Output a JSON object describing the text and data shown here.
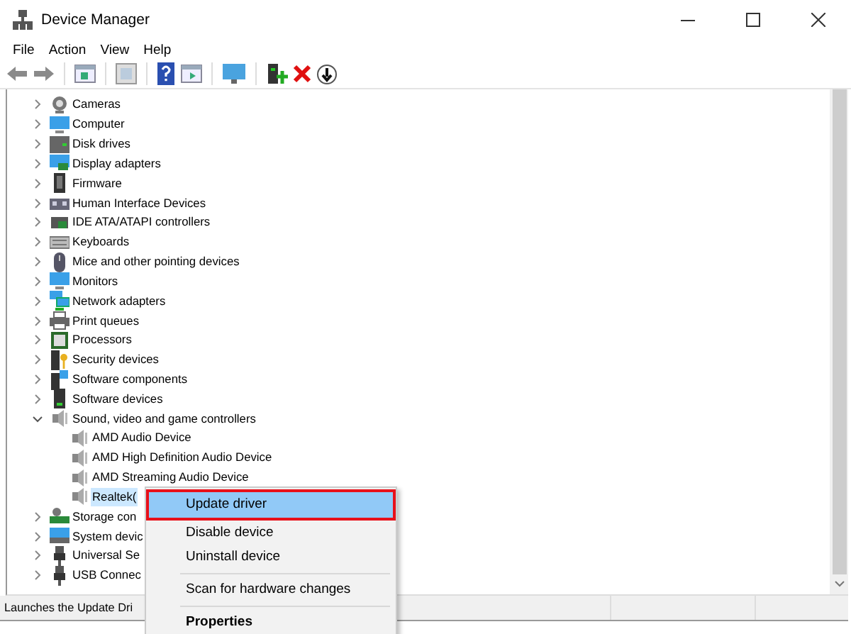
{
  "window": {
    "title": "Device Manager"
  },
  "menu_bar": [
    "File",
    "Action",
    "View",
    "Help"
  ],
  "tree": [
    {
      "label": "Cameras",
      "expanded": false,
      "selected": false
    },
    {
      "label": "Computer",
      "expanded": false,
      "selected": false
    },
    {
      "label": "Disk drives",
      "expanded": false,
      "selected": false
    },
    {
      "label": "Display adapters",
      "expanded": false,
      "selected": false
    },
    {
      "label": "Firmware",
      "expanded": false,
      "selected": false
    },
    {
      "label": "Human Interface Devices",
      "expanded": false,
      "selected": false
    },
    {
      "label": "IDE ATA/ATAPI controllers",
      "expanded": false,
      "selected": false
    },
    {
      "label": "Keyboards",
      "expanded": false,
      "selected": false
    },
    {
      "label": "Mice and other pointing devices",
      "expanded": false,
      "selected": false
    },
    {
      "label": "Monitors",
      "expanded": false,
      "selected": false
    },
    {
      "label": "Network adapters",
      "expanded": false,
      "selected": false
    },
    {
      "label": "Print queues",
      "expanded": false,
      "selected": false
    },
    {
      "label": "Processors",
      "expanded": false,
      "selected": false
    },
    {
      "label": "Security devices",
      "expanded": false,
      "selected": false
    },
    {
      "label": "Software components",
      "expanded": false,
      "selected": false
    },
    {
      "label": "Software devices",
      "expanded": false,
      "selected": false
    },
    {
      "label": "Sound, video and game controllers",
      "expanded": true,
      "selected": false,
      "children": [
        {
          "label": "AMD Audio Device",
          "selected": false
        },
        {
          "label": "AMD High Definition Audio Device",
          "selected": false
        },
        {
          "label": "AMD Streaming Audio Device",
          "selected": false
        },
        {
          "label": "Realtek(",
          "selected": true
        }
      ]
    },
    {
      "label": "Storage con",
      "expanded": false,
      "selected": false
    },
    {
      "label": "System devic",
      "expanded": false,
      "selected": false
    },
    {
      "label": "Universal Se",
      "expanded": false,
      "selected": false
    },
    {
      "label": "USB Connec",
      "expanded": false,
      "selected": false
    }
  ],
  "context_menu": [
    {
      "label": "Update driver",
      "selected": true,
      "outlined": true,
      "default": false
    },
    {
      "label": "Disable device",
      "selected": false,
      "outlined": false,
      "default": false
    },
    {
      "label": "Uninstall device",
      "selected": false,
      "outlined": false,
      "default": false,
      "separator_after": true
    },
    {
      "label": "Scan for hardware changes",
      "selected": false,
      "outlined": false,
      "default": false,
      "separator_after": true
    },
    {
      "label": "Properties",
      "selected": false,
      "outlined": false,
      "default": true
    }
  ],
  "status_bar": {
    "text": "Launches the Update Dri"
  }
}
